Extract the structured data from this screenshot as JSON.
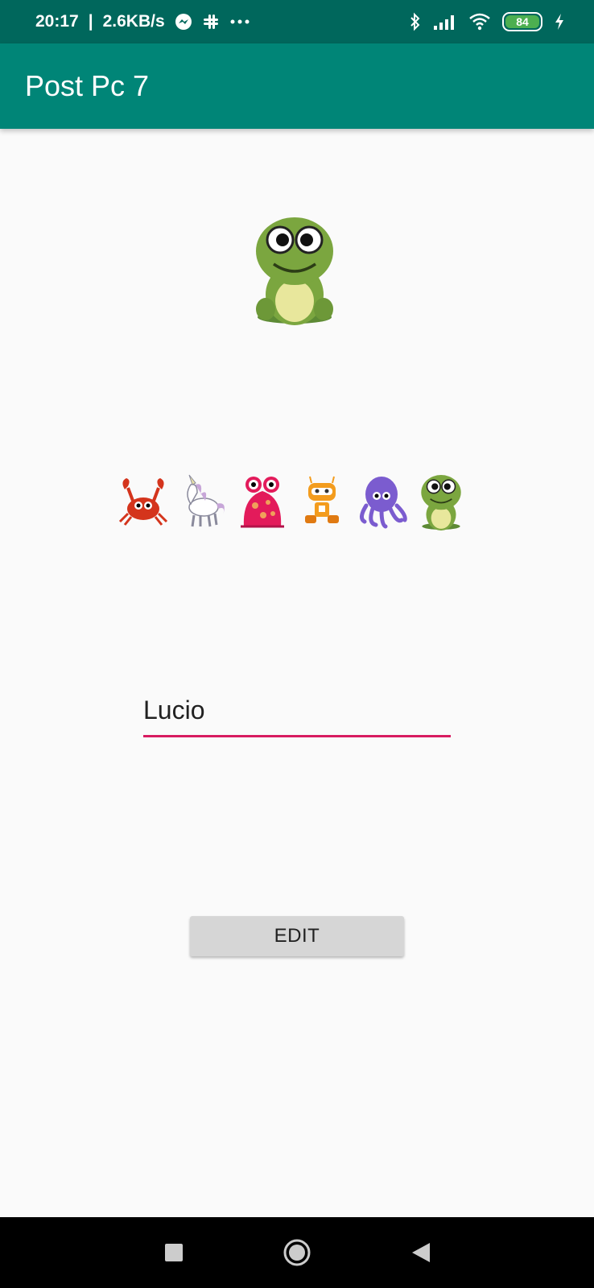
{
  "status_bar": {
    "time": "20:17",
    "net_speed": "2.6KB/s",
    "battery_level": "84",
    "icons": [
      "messenger-icon",
      "slack-icon",
      "more-icon",
      "bluetooth-icon",
      "signal-icon",
      "wifi-icon",
      "battery-icon",
      "charging-icon"
    ]
  },
  "app_bar": {
    "title": "Post Pc 7"
  },
  "avatar": {
    "selected": "frog-icon"
  },
  "picker": {
    "items": [
      "crab-icon",
      "unicorn-icon",
      "monster-icon",
      "robot-icon",
      "octopus-icon",
      "frog-icon"
    ]
  },
  "name_field": {
    "value": "Lucio"
  },
  "edit_button": {
    "label": "EDIT"
  },
  "nav_bar": {
    "icons": [
      "recents-icon",
      "home-icon",
      "back-icon"
    ]
  },
  "colors": {
    "status_bar": "#00675c",
    "app_bar": "#008577",
    "accent": "#d81b60",
    "background": "#fafafa",
    "button": "#d6d6d6"
  }
}
